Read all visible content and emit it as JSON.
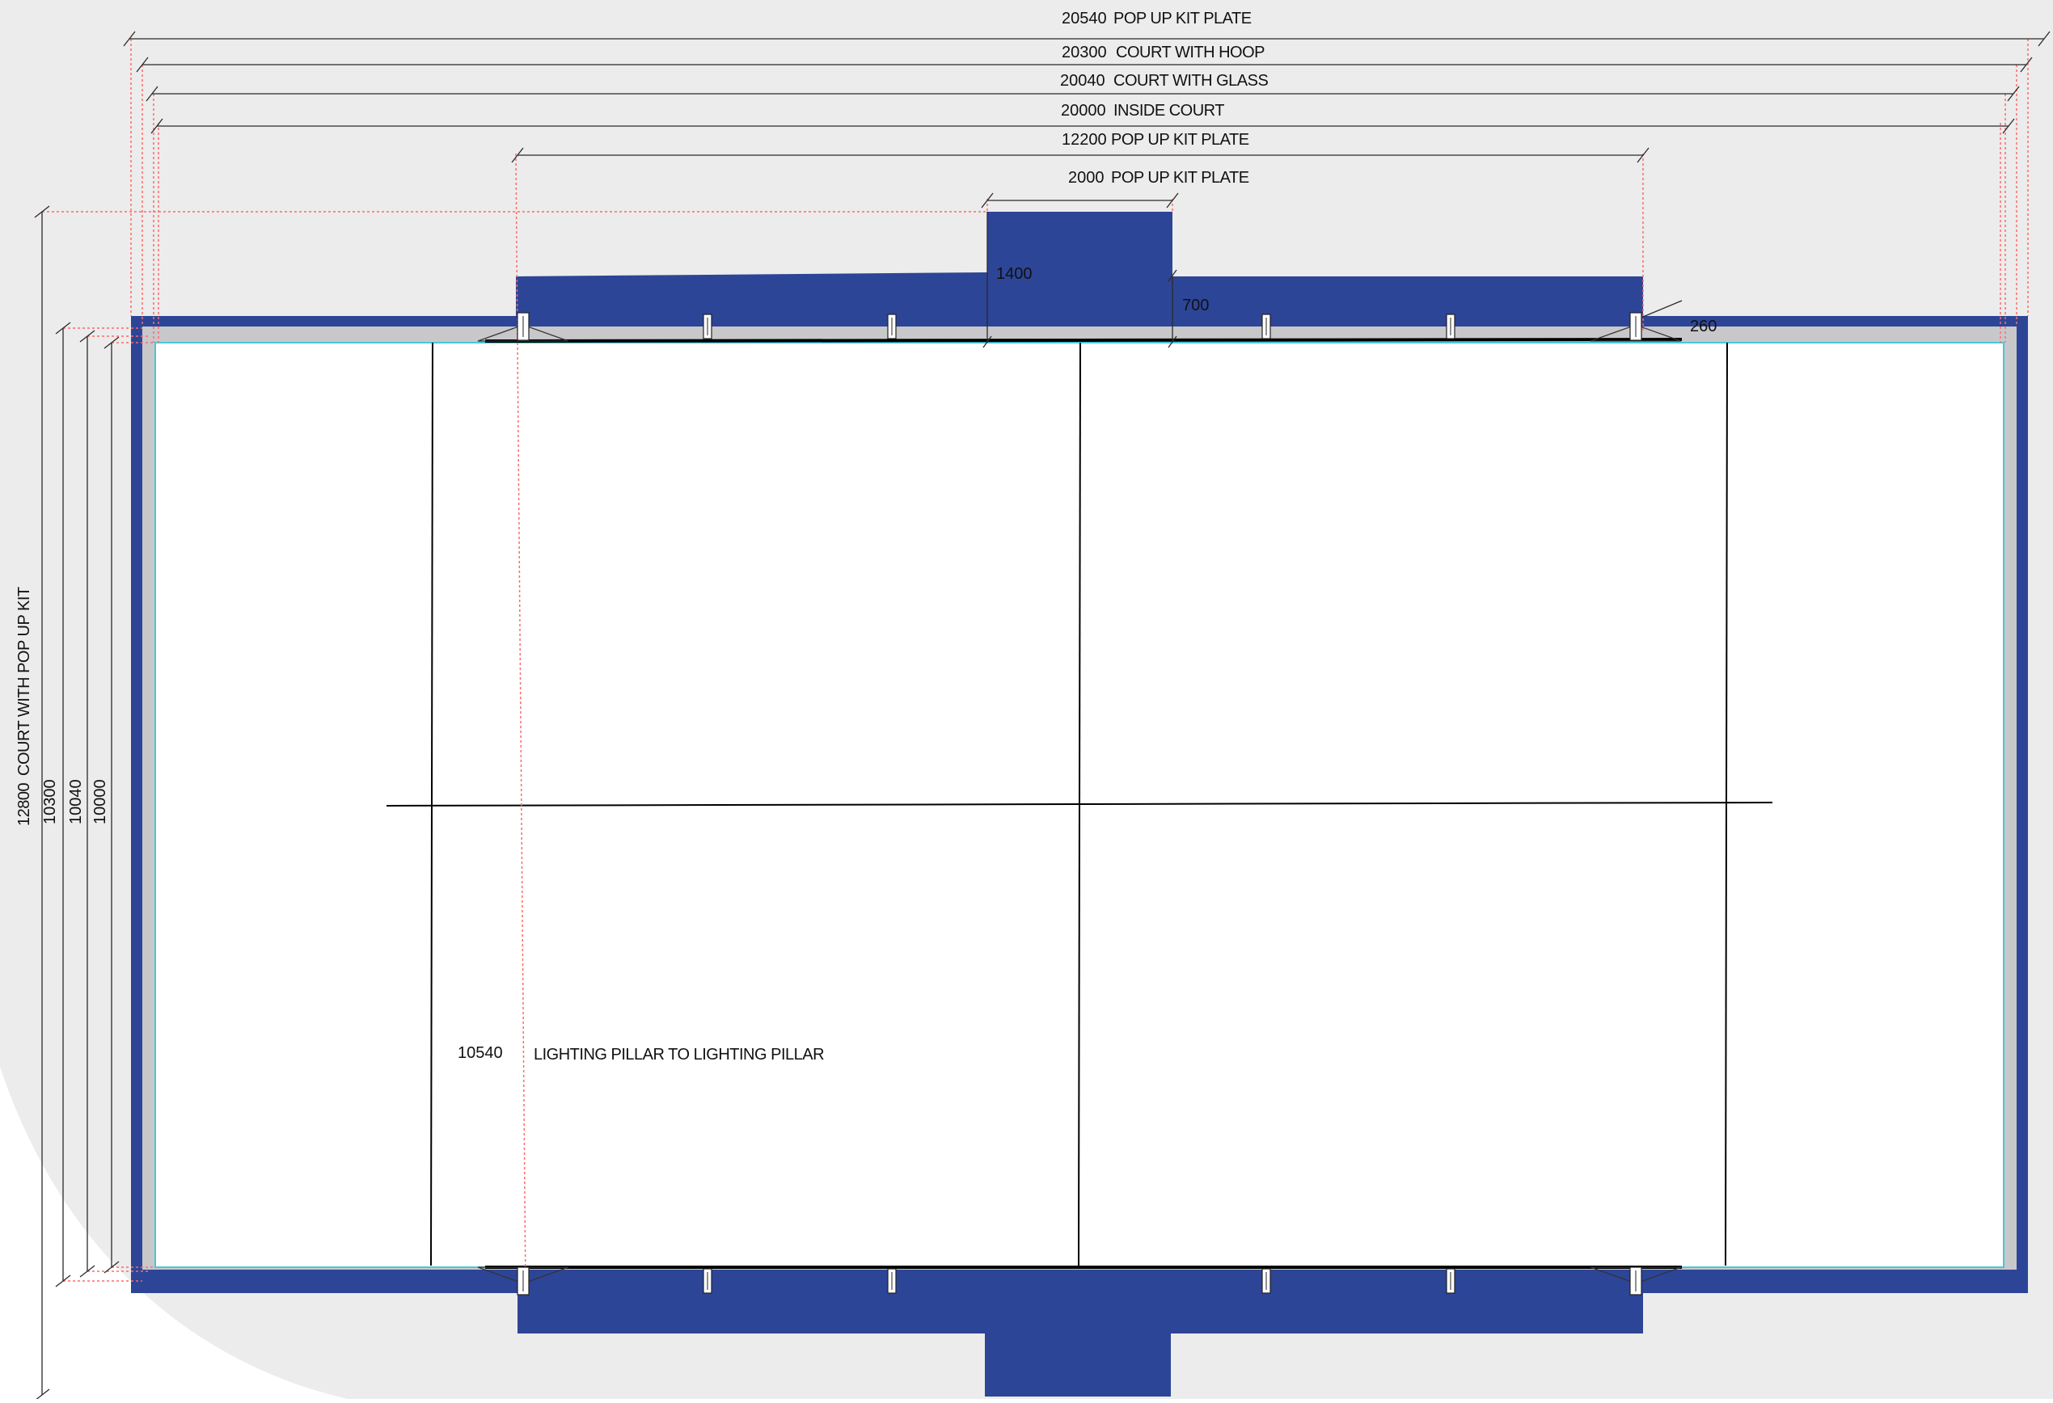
{
  "colors": {
    "background": "#ffffff",
    "grey_sweep": "#ececec",
    "plate_blue": "#2d4596",
    "court_outer": "#c8c8cb",
    "court_inner": "#ffffff",
    "glass_line": "#48c8d8",
    "dim_line": "#2a2a2a",
    "aux_line": "#ff6a6a"
  },
  "top_dimensions": [
    {
      "value": "20540",
      "label": "POP UP KIT PLATE"
    },
    {
      "value": "20300",
      "label": "COURT WITH HOOP"
    },
    {
      "value": "20040",
      "label": "COURT WITH GLASS"
    },
    {
      "value": "20000",
      "label": "INSIDE COURT"
    },
    {
      "value": "12200",
      "label": "POP UP KIT PLATE"
    },
    {
      "value": "2000",
      "label": "POP UP KIT PLATE"
    }
  ],
  "left_dimensions": [
    {
      "value": "12800",
      "label": "COURT WITH POP UP KIT"
    },
    {
      "value": "10300",
      "label": ""
    },
    {
      "value": "10040",
      "label": ""
    },
    {
      "value": "10000",
      "label": ""
    }
  ],
  "callouts": {
    "tab_height": "1400",
    "plate_depth": "700",
    "pillar_offset": "260"
  },
  "pillar_note": {
    "value": "10540",
    "label": "LIGHTING PILLAR  TO LIGHTING PILLAR"
  },
  "icons": {
    "lighting_pillar": "lighting-pillar-icon",
    "post": "post-icon"
  }
}
